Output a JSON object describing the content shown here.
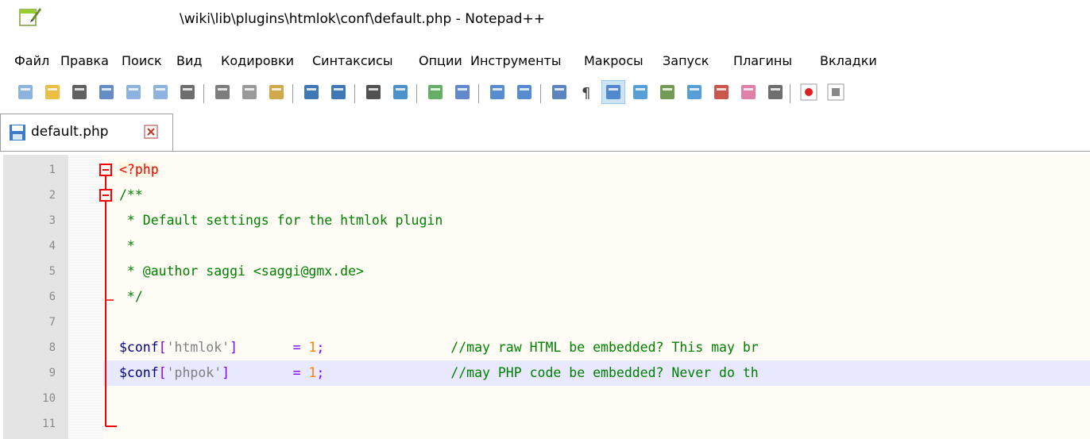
{
  "window": {
    "title": "\\wiki\\lib\\plugins\\htmlok\\conf\\default.php - Notepad++"
  },
  "menu": [
    "Файл",
    "Правка",
    "Поиск",
    "Вид",
    "Кодировки",
    "Синтаксисы",
    "Опции",
    "Инструменты",
    "Макросы",
    "Запуск",
    "Плагины",
    "Вкладки"
  ],
  "tab": {
    "label": "default.php"
  },
  "editor": {
    "line_numbers": [
      "1",
      "2",
      "3",
      "4",
      "5",
      "6",
      "7",
      "8",
      "9",
      "10",
      "11"
    ],
    "lines": [
      [
        {
          "t": "<?php",
          "c": "php-tag"
        }
      ],
      [
        {
          "t": "/**",
          "c": "comment"
        }
      ],
      [
        {
          "t": " * Default settings for the htmlok plugin",
          "c": "comment"
        }
      ],
      [
        {
          "t": " *",
          "c": "comment"
        }
      ],
      [
        {
          "t": " * @author saggi <saggi@gmx.de>",
          "c": "comment"
        }
      ],
      [
        {
          "t": " */",
          "c": "comment"
        }
      ],
      [],
      [
        {
          "t": "$conf",
          "c": "var"
        },
        {
          "t": "[",
          "c": "op"
        },
        {
          "t": "'htmlok'",
          "c": "str"
        },
        {
          "t": "]",
          "c": "op"
        },
        {
          "t": "       ",
          "c": ""
        },
        {
          "t": "=",
          "c": "op"
        },
        {
          "t": " ",
          "c": ""
        },
        {
          "t": "1",
          "c": "num"
        },
        {
          "t": ";",
          "c": "op"
        },
        {
          "t": "                //may raw HTML be embedded? This may br",
          "c": "comment"
        }
      ],
      [
        {
          "t": "$conf",
          "c": "var"
        },
        {
          "t": "[",
          "c": "op"
        },
        {
          "t": "'phpok'",
          "c": "str"
        },
        {
          "t": "]",
          "c": "op"
        },
        {
          "t": "        ",
          "c": ""
        },
        {
          "t": "=",
          "c": "op"
        },
        {
          "t": " ",
          "c": ""
        },
        {
          "t": "1",
          "c": "num"
        },
        {
          "t": ";",
          "c": "op"
        },
        {
          "t": "                //may PHP code be embedded? Never do th",
          "c": "comment"
        }
      ],
      [],
      []
    ],
    "current_line": 9
  },
  "toolbar_icons": [
    "new-file-icon",
    "open-file-icon",
    "save-icon",
    "save-all-icon",
    "close-icon",
    "close-all-icon",
    "print-icon",
    "cut-icon",
    "copy-icon",
    "paste-icon",
    "undo-icon",
    "redo-icon",
    "find-icon",
    "replace-icon",
    "zoom-in-icon",
    "zoom-out-icon",
    "sync-vertical-icon",
    "sync-horizontal-icon",
    "word-wrap-icon",
    "show-all-chars-icon",
    "indent-guide-icon",
    "udl-icon",
    "doc-map-icon",
    "doc-list-icon",
    "function-list-icon",
    "folder-workspace-icon",
    "monitoring-icon",
    "record-macro-icon",
    "stop-macro-icon"
  ],
  "colors": {
    "fold_marker": "#ff0000",
    "current_line_bg": "#e8e8ff",
    "editor_bg": "#fefcf5"
  }
}
